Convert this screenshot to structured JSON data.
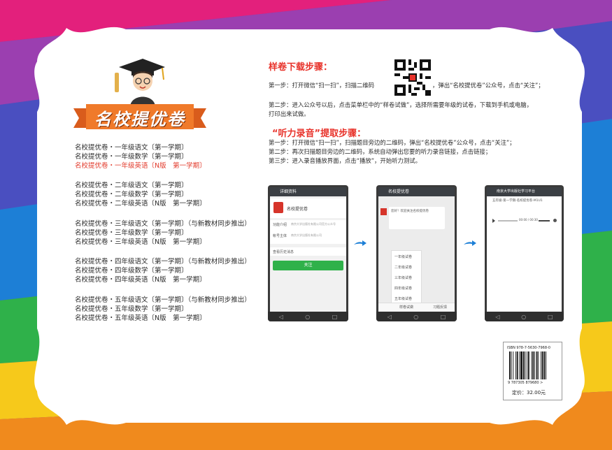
{
  "colors": {
    "accent": "#e8322a",
    "banner": "#f07a2a",
    "green": "#2fb14a",
    "wechat": "#3b3f44"
  },
  "banner": {
    "title": "名校提优卷"
  },
  "books": [
    {
      "text": "名校提优卷・一年级语文〔第一学期〕",
      "highlight": false
    },
    {
      "text": "名校提优卷・一年级数学〔第一学期〕",
      "highlight": false
    },
    {
      "text": "名校提优卷・一年级英语〔N版　第一学期〕",
      "highlight": true
    },
    {
      "text": "名校提优卷・二年级语文〔第一学期〕",
      "highlight": false
    },
    {
      "text": "名校提优卷・二年级数学〔第一学期〕",
      "highlight": false
    },
    {
      "text": "名校提优卷・二年级英语〔N版　第一学期〕",
      "highlight": false
    },
    {
      "text": "名校提优卷・三年级语文〔第一学期〕（与新教材同步推出）",
      "highlight": false
    },
    {
      "text": "名校提优卷・三年级数学〔第一学期〕",
      "highlight": false
    },
    {
      "text": "名校提优卷・三年级英语〔N版　第一学期〕",
      "highlight": false
    },
    {
      "text": "名校提优卷・四年级语文〔第一学期〕（与新教材同步推出）",
      "highlight": false
    },
    {
      "text": "名校提优卷・四年级数学〔第一学期〕",
      "highlight": false
    },
    {
      "text": "名校提优卷・四年级英语〔N版　第一学期〕",
      "highlight": false
    },
    {
      "text": "名校提优卷・五年级语文〔第一学期〕（与新教材同步推出）",
      "highlight": false
    },
    {
      "text": "名校提优卷・五年级数学〔第一学期〕",
      "highlight": false
    },
    {
      "text": "名校提优卷・五年级英语〔N版　第一学期〕",
      "highlight": false
    }
  ],
  "download": {
    "heading": "样卷下载步骤：",
    "step1a": "第一步：打开微信“扫一扫”，扫描二维码",
    "step1b": "，弹出“名校提优卷”公众号，点击“关注”；",
    "step2a": "第二步：进入公众号以后，点击菜单栏中的“样卷试做”，选择所需要年级的试卷，下载到手机或电脑，",
    "step2b": "打印出来试做。"
  },
  "listen": {
    "heading": "“听力录音”提取步骤：",
    "step1": "第一步：打开微信“扫一扫”，扫描题目旁边的二维码，弹出“名校提优卷”公众号，点击“关注”；",
    "step2": "第二步：再次扫描题目旁边的二维码，系统自动弹出您要的听力录音链接，点击链接；",
    "step3": "第三步：进入录音播放界面，点击“播放”，开始听力测试。"
  },
  "phone1": {
    "bar": "详细资料",
    "name": "名校提优卷",
    "row1k": "功能介绍",
    "row1v": "南京大学出版社有限公司官方公众号",
    "row2k": "帐号主体",
    "row2v": "南京大学出版社有限公司",
    "row3": "查看历史消息",
    "follow": "关注"
  },
  "phone2": {
    "bar": "名校提优卷",
    "msg": "您好！欢迎关注名校提优卷",
    "menu": [
      "一年级试卷",
      "二年级试卷",
      "三年级试卷",
      "四年级试卷",
      "五年级试卷"
    ],
    "tab1": "样卷试做",
    "tab2": "习题反馈"
  },
  "phone3": {
    "bar": "南京大学出版社学习平台",
    "title": "五年级-第一学期-名校提优卷-M1U1",
    "time": "00:00 / 00:30"
  },
  "barcode": {
    "isbn": "ISBN 978-7-5630-7968-0",
    "digits": "9 787305 879680 >",
    "price": "定价：32.00元"
  }
}
